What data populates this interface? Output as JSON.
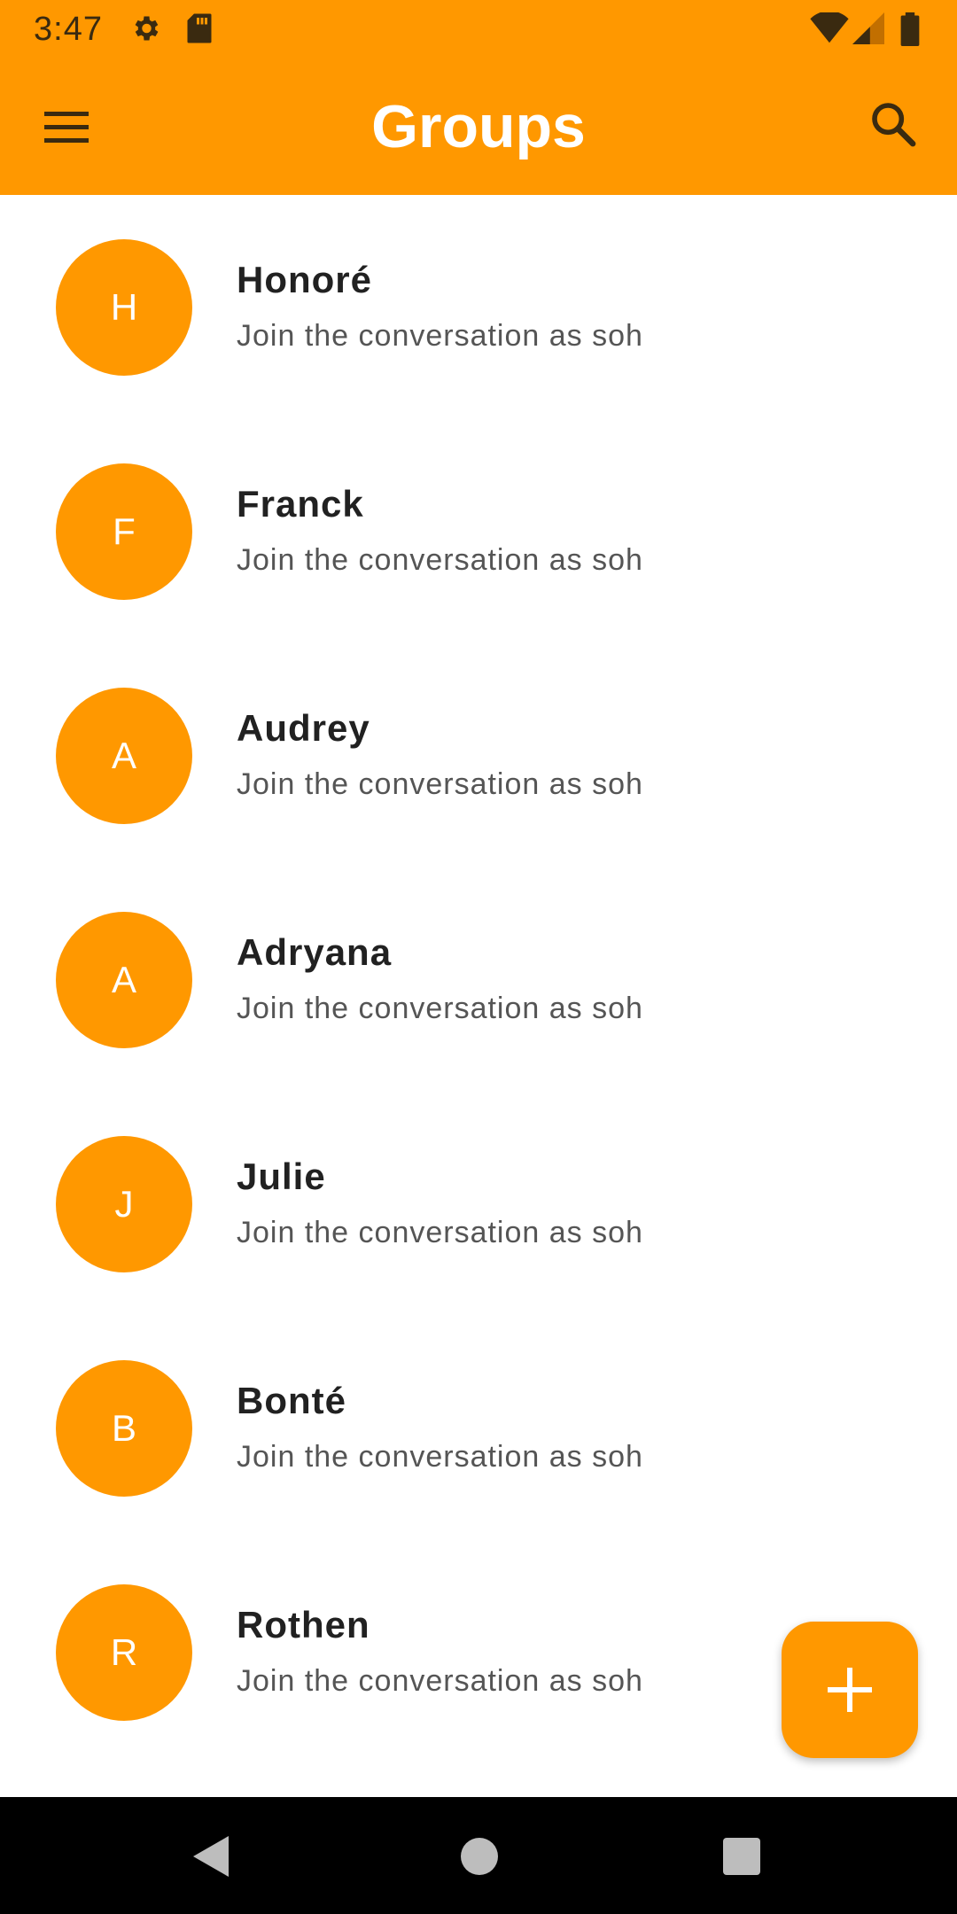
{
  "status_bar": {
    "time": "3:47",
    "icons": [
      "gear-icon",
      "sd-card-icon",
      "wifi-icon",
      "signal-icon",
      "battery-icon"
    ]
  },
  "app_bar": {
    "title": "Groups",
    "menu_icon": "menu-icon",
    "search_icon": "search-icon"
  },
  "groups": [
    {
      "initial": "H",
      "name": "Honoré",
      "subtitle": "Join the conversation as soh"
    },
    {
      "initial": "F",
      "name": "Franck",
      "subtitle": "Join the conversation as soh"
    },
    {
      "initial": "A",
      "name": "Audrey",
      "subtitle": "Join the conversation as soh"
    },
    {
      "initial": "A",
      "name": "Adryana",
      "subtitle": "Join the conversation as soh"
    },
    {
      "initial": "J",
      "name": "Julie",
      "subtitle": "Join the conversation as soh"
    },
    {
      "initial": "B",
      "name": "Bonté",
      "subtitle": "Join the conversation as soh"
    },
    {
      "initial": "R",
      "name": "Rothen",
      "subtitle": "Join the conversation as soh"
    }
  ],
  "fab": {
    "icon": "plus-icon"
  },
  "nav_bar": {
    "icons": [
      "back-icon",
      "home-icon",
      "recents-icon"
    ]
  },
  "colors": {
    "accent": "#FF9800",
    "nav_bg": "#000000",
    "name_text": "#212121",
    "subtitle_text": "#555555"
  }
}
